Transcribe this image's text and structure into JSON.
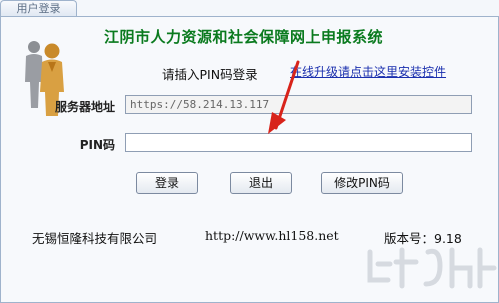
{
  "tab": {
    "label": "用户登录"
  },
  "title": "江阴市人力资源和社会保障网上申报系统",
  "prompt": "请插入PIN码登录",
  "upgrade_link": "在线升级请点击这里安装控件",
  "server": {
    "label": "服务器地址",
    "value": "https://58.214.13.117"
  },
  "pin": {
    "label": "PIN码",
    "value": ""
  },
  "buttons": {
    "login": "登录",
    "exit": "退出",
    "change_pin": "修改PIN码"
  },
  "footer": {
    "company": "无锡恒隆科技有限公司",
    "url": "http://www.hl158.net",
    "version_label": "版本号：9.18"
  },
  "colors": {
    "title": "#0a7a1e",
    "link": "#1a2fae",
    "arrow": "#d8231a"
  },
  "watermark": {
    "domain_text": "www.xz7.com"
  }
}
